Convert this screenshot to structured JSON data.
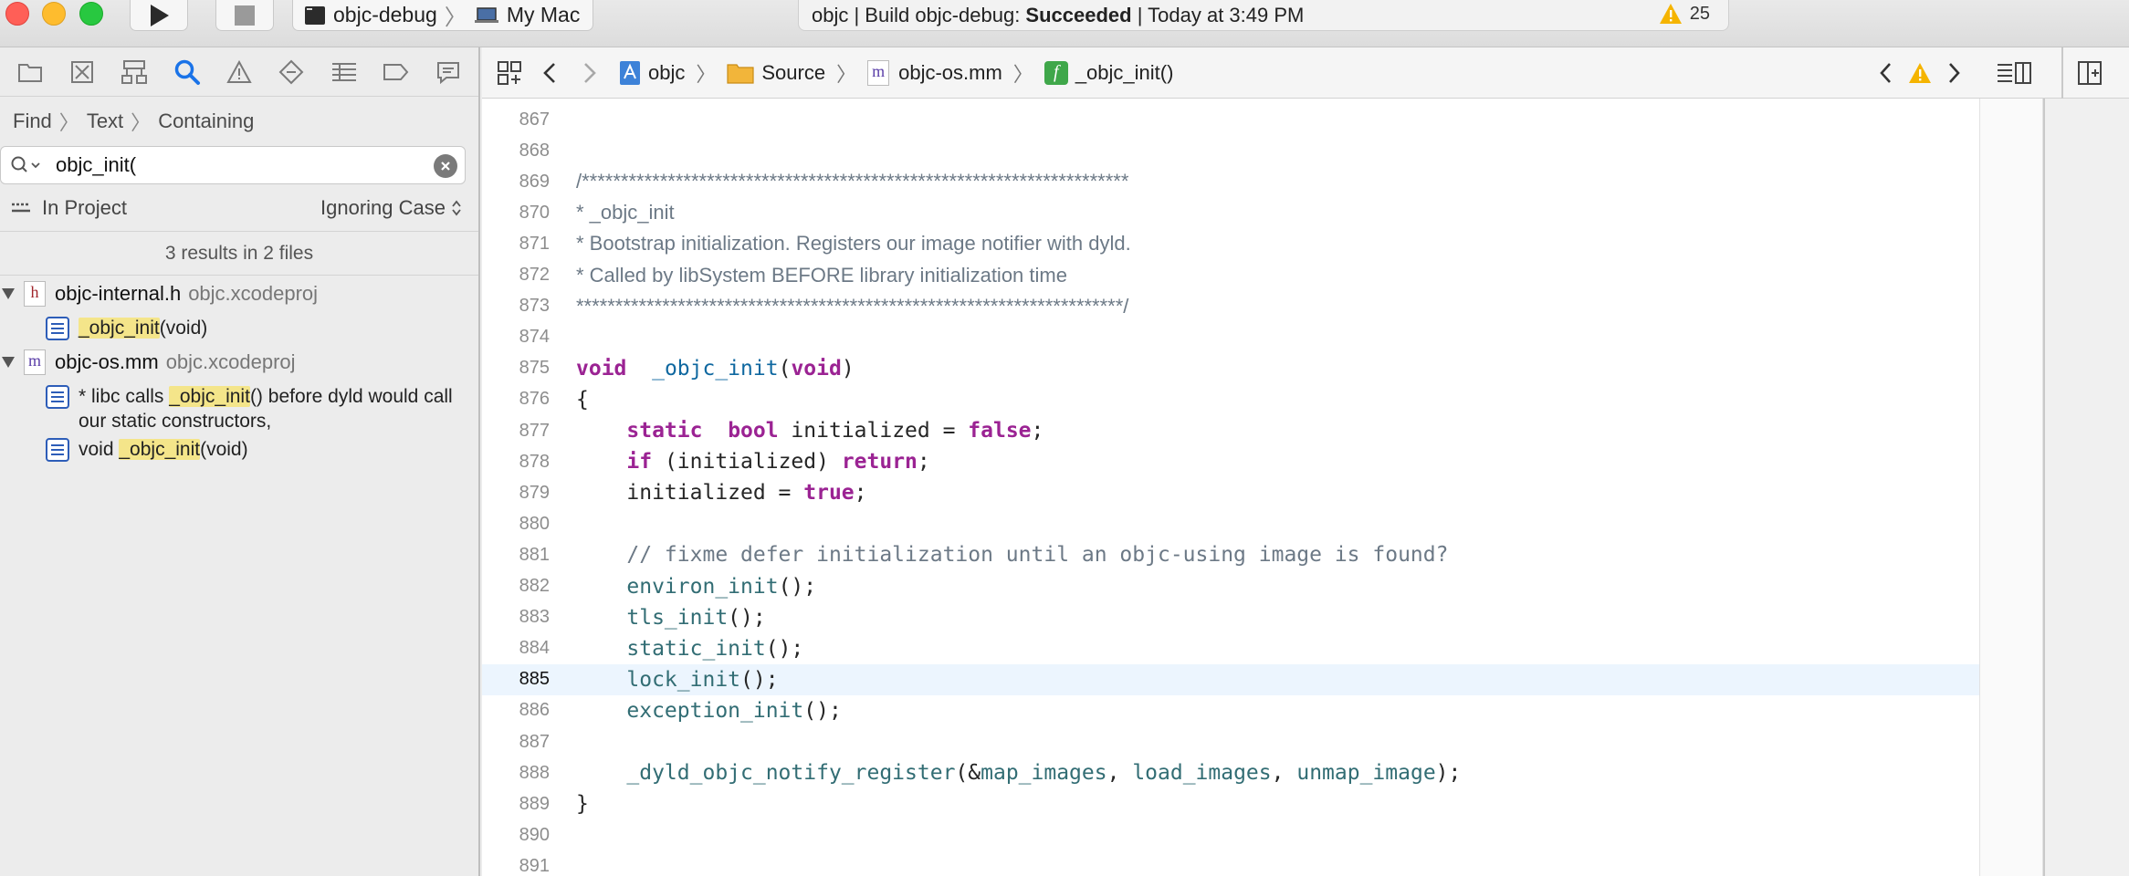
{
  "titlebar": {
    "scheme": "objc-debug",
    "destination": "My Mac",
    "activity": {
      "prefix": "objc | Build objc-debug: ",
      "status": "Succeeded",
      "suffix": " | Today at 3:49 PM"
    },
    "warning_count": "25"
  },
  "navigator": {
    "find_path": [
      "Find",
      "Text",
      "Containing"
    ],
    "search_value": "objc_init(",
    "scope": "In Project",
    "case_mode": "Ignoring Case",
    "results_summary": "3 results in 2 files",
    "files": [
      {
        "name": "objc-internal.h",
        "project": "objc.xcodeproj",
        "icon_letter": "h",
        "matches": [
          {
            "pre": "",
            "hl": "_objc_init",
            "post": "(void)"
          }
        ]
      },
      {
        "name": "objc-os.mm",
        "project": "objc.xcodeproj",
        "icon_letter": "m",
        "matches": [
          {
            "pre": "* libc calls ",
            "hl": "_objc_init",
            "post": "() before dyld would call our static constructors,"
          },
          {
            "pre": "void ",
            "hl": "_objc_init",
            "post": "(void)"
          }
        ]
      }
    ]
  },
  "jumpbar": {
    "crumbs": [
      "objc",
      "Source",
      "objc-os.mm",
      "_objc_init()"
    ],
    "crumb_letter_m": "m",
    "crumb_letter_f": "f"
  },
  "editor": {
    "current_line": 885,
    "lines": [
      {
        "n": "867"
      },
      {
        "n": "868"
      },
      {
        "n": "869",
        "comment": "/**********************************************************************"
      },
      {
        "n": "870",
        "comment": "* _objc_init"
      },
      {
        "n": "871",
        "comment": "* Bootstrap initialization. Registers our image notifier with dyld."
      },
      {
        "n": "872",
        "comment": "* Called by libSystem BEFORE library initialization time"
      },
      {
        "n": "873",
        "comment": "**********************************************************************/"
      },
      {
        "n": "874"
      },
      {
        "n": "875",
        "tokens": [
          [
            "kw",
            "void"
          ],
          [
            "",
            "  "
          ],
          [
            "fnd",
            "_objc_init"
          ],
          [
            "",
            "("
          ],
          [
            "kw",
            "void"
          ],
          [
            "",
            ")"
          ]
        ]
      },
      {
        "n": "876",
        "tokens": [
          [
            "",
            "{"
          ]
        ]
      },
      {
        "n": "877",
        "tokens": [
          [
            "",
            "    "
          ],
          [
            "kw",
            "static"
          ],
          [
            "",
            "  "
          ],
          [
            "kw",
            "bool"
          ],
          [
            "",
            " initialized = "
          ],
          [
            "kw",
            "false"
          ],
          [
            "",
            ";"
          ]
        ]
      },
      {
        "n": "878",
        "tokens": [
          [
            "",
            "    "
          ],
          [
            "kw",
            "if"
          ],
          [
            "",
            " (initialized) "
          ],
          [
            "kw",
            "return"
          ],
          [
            "",
            ";"
          ]
        ]
      },
      {
        "n": "879",
        "tokens": [
          [
            "",
            "    initialized = "
          ],
          [
            "kw",
            "true"
          ],
          [
            "",
            ";"
          ]
        ]
      },
      {
        "n": "880"
      },
      {
        "n": "881",
        "tokens": [
          [
            "",
            "    "
          ],
          [
            "cm",
            "// fixme defer initialization until an objc-using image is found?"
          ]
        ]
      },
      {
        "n": "882",
        "tokens": [
          [
            "",
            "    "
          ],
          [
            "fn",
            "environ_init"
          ],
          [
            "",
            "();"
          ]
        ]
      },
      {
        "n": "883",
        "tokens": [
          [
            "",
            "    "
          ],
          [
            "fn",
            "tls_init"
          ],
          [
            "",
            "();"
          ]
        ]
      },
      {
        "n": "884",
        "tokens": [
          [
            "",
            "    "
          ],
          [
            "fn",
            "static_init"
          ],
          [
            "",
            "();"
          ]
        ]
      },
      {
        "n": "885",
        "tokens": [
          [
            "",
            "    "
          ],
          [
            "fn",
            "lock_init"
          ],
          [
            "",
            "();"
          ]
        ]
      },
      {
        "n": "886",
        "tokens": [
          [
            "",
            "    "
          ],
          [
            "fn",
            "exception_init"
          ],
          [
            "",
            "();"
          ]
        ]
      },
      {
        "n": "887"
      },
      {
        "n": "888",
        "tokens": [
          [
            "",
            "    "
          ],
          [
            "fn",
            "_dyld_objc_notify_register"
          ],
          [
            "",
            "(&"
          ],
          [
            "fn",
            "map_images"
          ],
          [
            "",
            ", "
          ],
          [
            "fn",
            "load_images"
          ],
          [
            "",
            ", "
          ],
          [
            "fn",
            "unmap_image"
          ],
          [
            "",
            ");"
          ]
        ]
      },
      {
        "n": "889",
        "tokens": [
          [
            "",
            "}"
          ]
        ]
      },
      {
        "n": "890"
      },
      {
        "n": "891"
      }
    ]
  },
  "colors": {
    "keyword": "#9b2393",
    "function": "#326d74",
    "comment": "#6c7986",
    "highlight": "#f4e58a",
    "current_line": "#ecf5fe"
  }
}
